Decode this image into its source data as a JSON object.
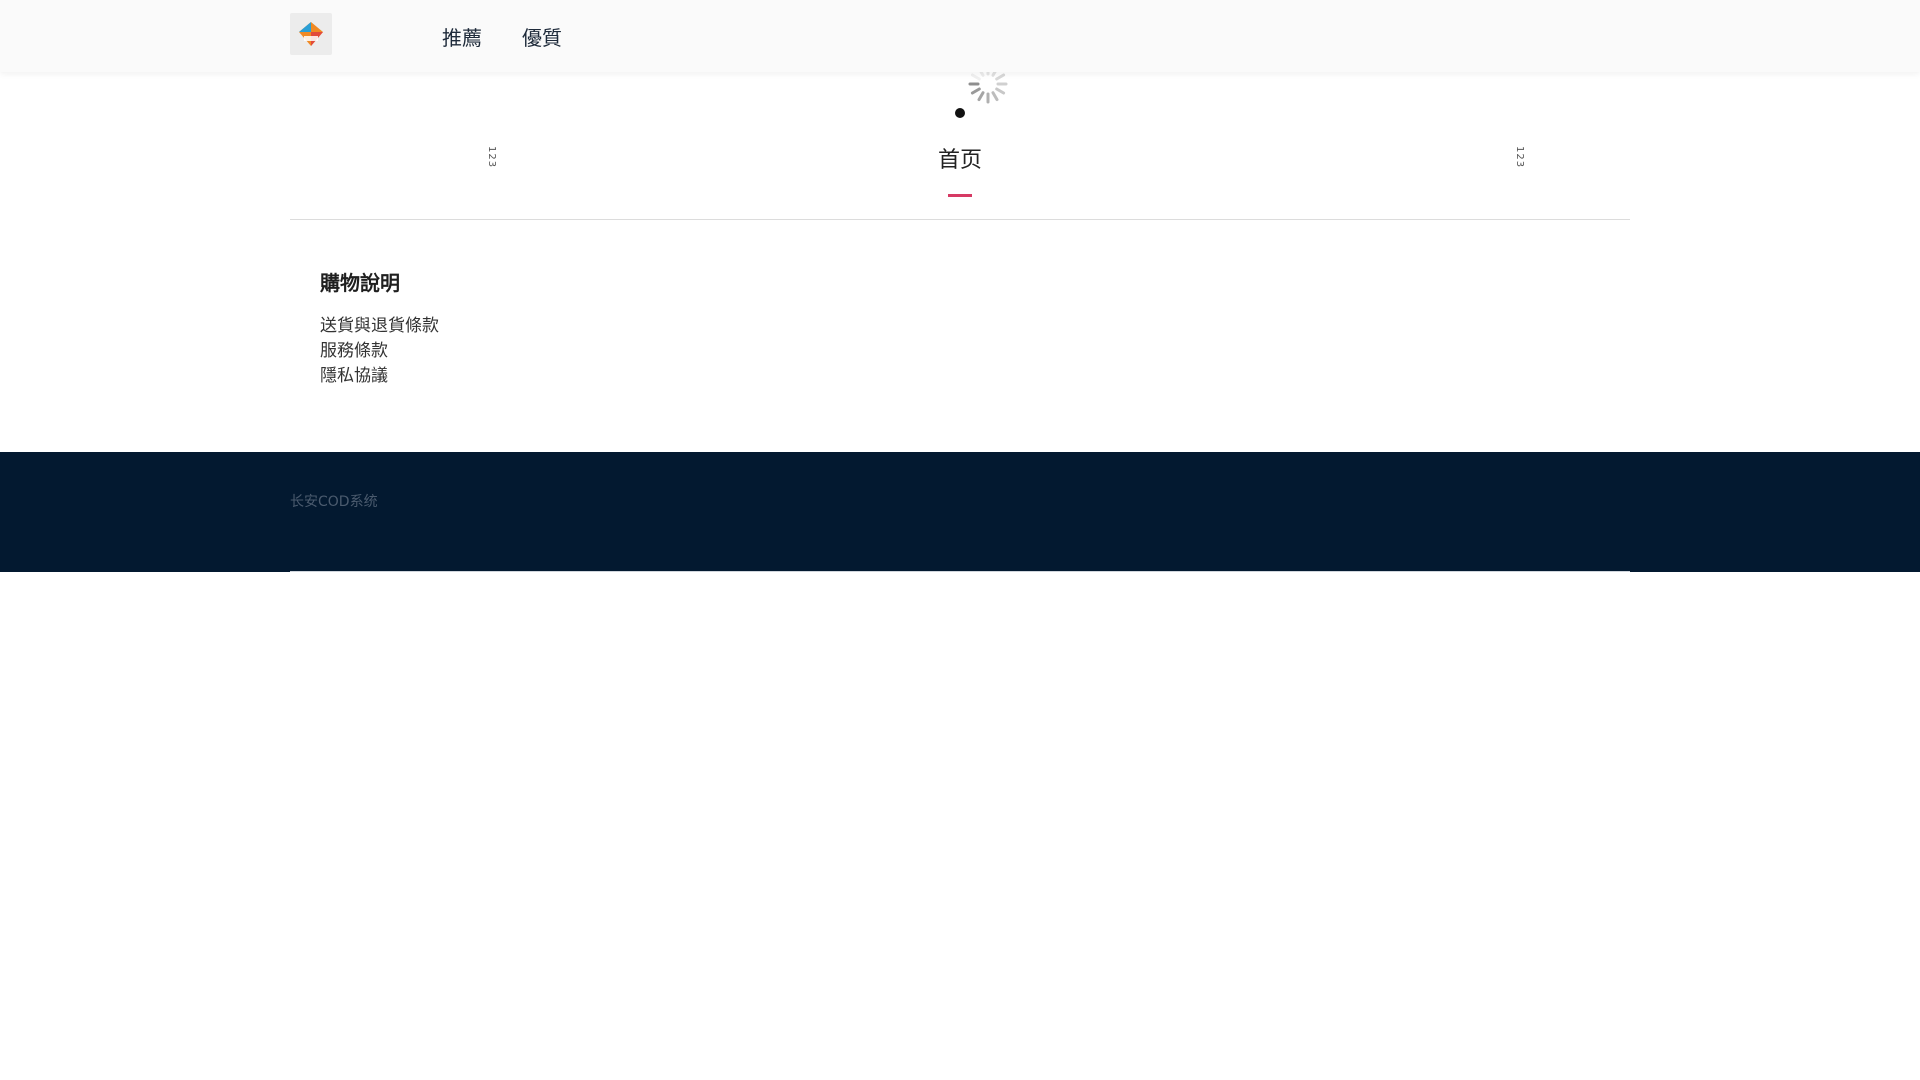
{
  "header": {
    "logo_icon": "brand-logo-icon",
    "nav": [
      {
        "label": "推薦"
      },
      {
        "label": "優質"
      }
    ]
  },
  "banner": {
    "left_label": "123",
    "right_label": "123",
    "loading_icon": "spinner-icon"
  },
  "main": {
    "tab_title": "首页",
    "accent_color": "#d63a64"
  },
  "shopping_info": {
    "title": "購物說明",
    "links": [
      {
        "label": "送貨與退貨條款"
      },
      {
        "label": "服務條款"
      },
      {
        "label": "隱私協議"
      }
    ]
  },
  "footer": {
    "text": "长安COD系统",
    "background_color": "#031930"
  }
}
